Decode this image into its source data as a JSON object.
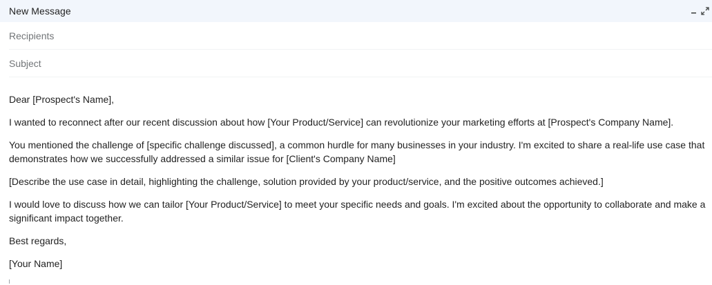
{
  "window": {
    "title": "New Message",
    "minimize_icon": "minimize-icon",
    "expand_icon": "expand-diagonal-icon"
  },
  "fields": {
    "recipients_placeholder": "Recipients",
    "subject_placeholder": "Subject"
  },
  "body": {
    "greeting": "Dear [Prospect's Name],",
    "paragraph1": "I wanted to reconnect after our recent discussion about how [Your Product/Service] can revolutionize your marketing efforts at [Prospect's Company Name].",
    "paragraph2": "You mentioned the challenge of [specific challenge discussed], a common hurdle for many businesses in your industry. I'm excited to share a real-life use case that demonstrates how we successfully addressed a similar issue for [Client's Company Name]",
    "paragraph3": "[Describe the use case in detail, highlighting the challenge, solution provided by your product/service, and the positive outcomes achieved.]",
    "paragraph4": "I would love to discuss how we can tailor [Your Product/Service] to meet your specific needs and goals. I'm excited about the opportunity to collaborate and make a significant impact together.",
    "closing": "Best regards,",
    "signature": "[Your Name]"
  },
  "colors": {
    "title_bar_bg": "#f2f6fc",
    "text": "#222222",
    "placeholder": "#727578"
  }
}
